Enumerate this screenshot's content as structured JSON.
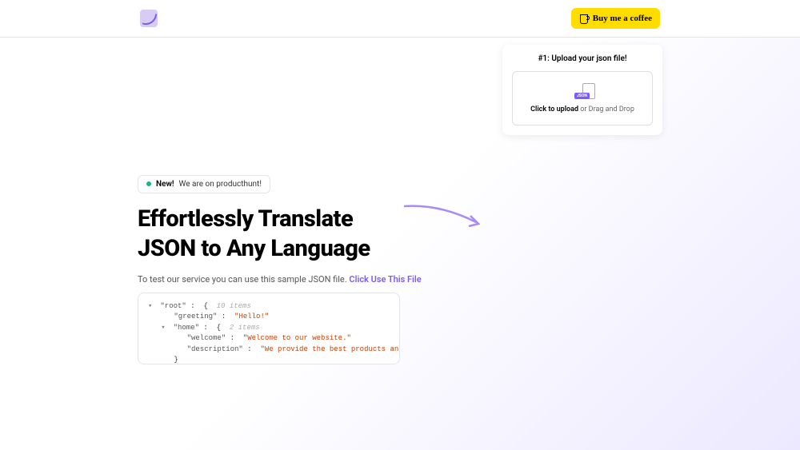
{
  "header": {
    "coffee_button": "Buy me a coffee"
  },
  "upload": {
    "title": "#1: Upload your json file!",
    "click_label": "Click to upload",
    "or_text": " or Drag and Drop"
  },
  "badge": {
    "new_label": "New!",
    "text": "We are on producthunt!"
  },
  "hero": {
    "title_line1": "Effortlessly Translate",
    "title_line2": "JSON to Any Language"
  },
  "subtitle": {
    "text": "To test our service you can use this sample JSON file. ",
    "link": "Click Use This File"
  },
  "json_preview": {
    "root_key": "\"root\"",
    "root_meta": "10 items",
    "greeting_key": "\"greeting\"",
    "greeting_val": "\"Hello!\"",
    "home_key": "\"home\"",
    "home_meta": "2 items",
    "welcome_key": "\"welcome\"",
    "welcome_val": "\"Welcome to our website.\"",
    "description_key": "\"description\"",
    "description_val": "\"We provide the best products and services.\""
  }
}
